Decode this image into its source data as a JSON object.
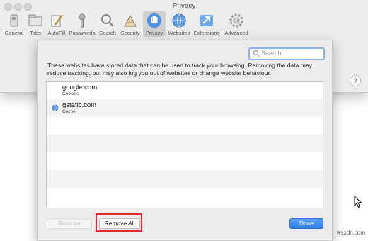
{
  "window": {
    "title": "Privacy"
  },
  "toolbar": {
    "items": [
      {
        "label": "General",
        "icon": "general-icon"
      },
      {
        "label": "Tabs",
        "icon": "tabs-icon"
      },
      {
        "label": "AutoFill",
        "icon": "autofill-icon"
      },
      {
        "label": "Passwords",
        "icon": "key-icon"
      },
      {
        "label": "Search",
        "icon": "search-icon"
      },
      {
        "label": "Security",
        "icon": "security-icon"
      },
      {
        "label": "Privacy",
        "icon": "privacy-hand-icon",
        "active": true
      },
      {
        "label": "Websites",
        "icon": "globe-icon"
      },
      {
        "label": "Extensions",
        "icon": "extensions-icon"
      },
      {
        "label": "Advanced",
        "icon": "gear-icon"
      }
    ]
  },
  "help": {
    "label": "?"
  },
  "sheet": {
    "search_placeholder": "Search",
    "description": "These websites have stored data that can be used to track your browsing. Removing the data may reduce tracking, but may also log you out of websites or change website behaviour.",
    "websites": [
      {
        "site": "google.com",
        "kind": "Cookies",
        "icon": "none"
      },
      {
        "site": "gstatic.com",
        "kind": "Cache",
        "icon": "globe-icon"
      }
    ],
    "buttons": {
      "remove": "Remove",
      "remove_all": "Remove All",
      "done": "Done"
    }
  },
  "watermark": "wsxdn.com",
  "colors": {
    "accent": "#2f7de7",
    "highlight": "#e02b2b",
    "privacy_icon": "#4a8fe0"
  }
}
